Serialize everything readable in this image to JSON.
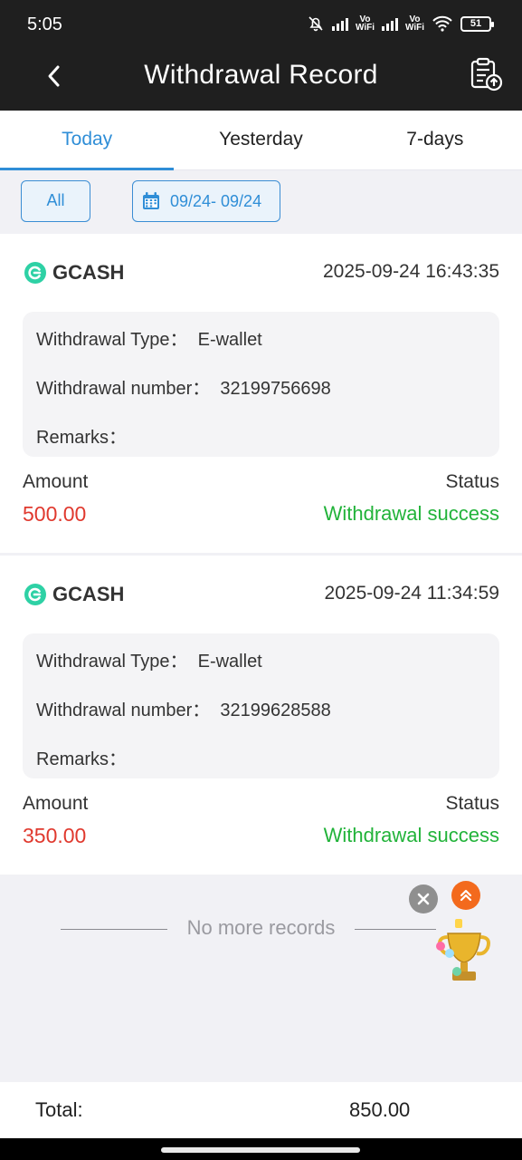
{
  "status_bar": {
    "time": "5:05",
    "battery": "51",
    "vowifi_1": [
      "Vo",
      "WiFi"
    ],
    "vowifi_2": [
      "Vo",
      "WiFi"
    ]
  },
  "header": {
    "title": "Withdrawal Record",
    "back_icon": "chevron-left-icon",
    "right_icon": "clipboard-upload-icon"
  },
  "tabs": [
    {
      "label": "Today",
      "active": true
    },
    {
      "label": "Yesterday",
      "active": false
    },
    {
      "label": "7-days",
      "active": false
    }
  ],
  "filters": {
    "all_label": "All",
    "date_range": "09/24- 09/24",
    "date_icon": "calendar-icon"
  },
  "records": [
    {
      "channel": "GCASH",
      "time": "2025-09-24 16:43:35",
      "type_label": "Withdrawal Type：",
      "type_value": "E-wallet",
      "number_label": "Withdrawal number：",
      "number_value": "32199756698",
      "remarks_label": "Remarks：",
      "amount_label": "Amount",
      "amount": "500.00",
      "status_label": "Status",
      "status": "Withdrawal success"
    },
    {
      "channel": "GCASH",
      "time": "2025-09-24 11:34:59",
      "type_label": "Withdrawal Type：",
      "type_value": "E-wallet",
      "number_label": "Withdrawal number：",
      "number_value": "32199628588",
      "remarks_label": "Remarks：",
      "amount_label": "Amount",
      "amount": "350.00",
      "status_label": "Status",
      "status": "Withdrawal success"
    }
  ],
  "no_more_text": "No more records",
  "total": {
    "label": "Total:",
    "value": "850.00"
  },
  "colors": {
    "accent": "#2f8ed7",
    "amount": "#e0392e",
    "success": "#22b33a",
    "header_bg": "#1f1f1f"
  }
}
